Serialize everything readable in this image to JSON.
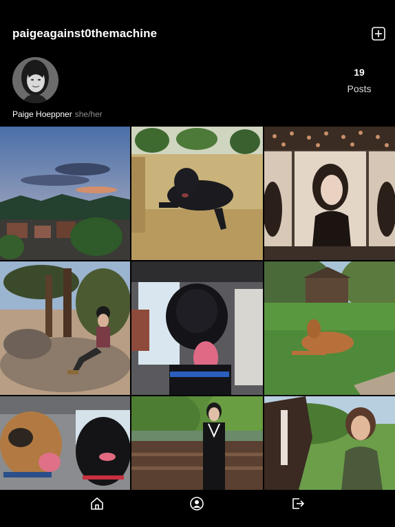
{
  "profile": {
    "username": "paigeagainst0themachine",
    "display_name": "Paige Hoeppner",
    "pronouns": "she/her",
    "posts_count": "19",
    "posts_label": "Posts"
  },
  "header": {
    "add_icon": "plus-square-icon"
  },
  "grid": {
    "posts": [
      {
        "id": "post-1",
        "subject": "sunset mountain town"
      },
      {
        "id": "post-2",
        "subject": "black dog on couch"
      },
      {
        "id": "post-3",
        "subject": "photobooth portrait"
      },
      {
        "id": "post-4",
        "subject": "woman sitting on rocks"
      },
      {
        "id": "post-5",
        "subject": "dog yawning in car"
      },
      {
        "id": "post-6",
        "subject": "dog lying on grass"
      },
      {
        "id": "post-7",
        "subject": "two dogs in car"
      },
      {
        "id": "post-8",
        "subject": "woman on bridge"
      },
      {
        "id": "post-9",
        "subject": "woman with horse"
      }
    ]
  },
  "tabbar": {
    "items": [
      {
        "name": "home",
        "icon": "home-icon"
      },
      {
        "name": "profile",
        "icon": "profile-icon"
      },
      {
        "name": "logout",
        "icon": "logout-icon"
      }
    ]
  }
}
